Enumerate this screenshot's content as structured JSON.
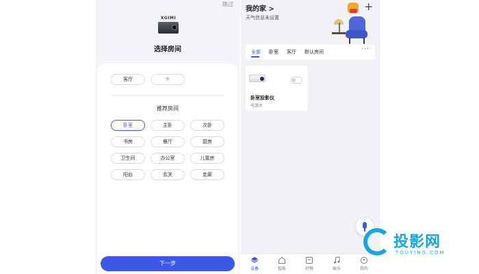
{
  "left": {
    "skip_label": "跳过",
    "brand": "XGIMI",
    "title": "选择房间",
    "selected_rooms": [
      "客厅"
    ],
    "add_label": "+",
    "recommend_title": "推荐房间",
    "recommended": [
      [
        "卧室",
        "主卧",
        "次卧"
      ],
      [
        "书房",
        "餐厅",
        "厨房"
      ],
      [
        "卫生间",
        "办公室",
        "儿童房"
      ],
      [
        "阳台",
        "玄关",
        "走廊"
      ]
    ],
    "selected_recommended": "卧室",
    "next_label": "下一步",
    "accent": "#3d57e8"
  },
  "right": {
    "home_title": "我的家 >",
    "weather": "天气信息未设置",
    "plus_label": "+",
    "tabs": [
      "全部",
      "卧室",
      "客厅",
      "默认房间"
    ],
    "active_tab": "全部",
    "more_label": "···",
    "device": {
      "name": "卧室投影仪",
      "status": "电源关",
      "power_on": false
    },
    "nav": [
      {
        "label": "设备",
        "icon": "layers-icon",
        "active": true
      },
      {
        "label": "智能",
        "icon": "home-icon",
        "active": false
      },
      {
        "label": "好物",
        "icon": "bag-icon",
        "active": false
      },
      {
        "label": "娱乐",
        "icon": "music-icon",
        "active": false
      },
      {
        "label": "我的",
        "icon": "profile-icon",
        "active": false
      }
    ]
  },
  "watermark": {
    "text": "投影网",
    "url": "TOUYING.COM",
    "color": "#19a6e0"
  }
}
